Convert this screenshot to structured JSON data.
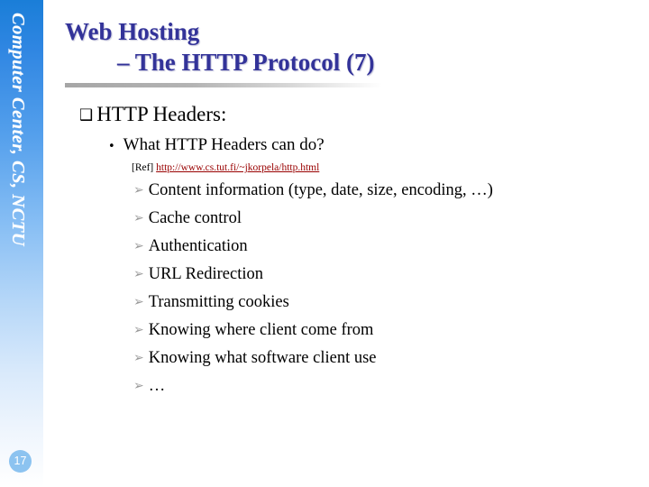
{
  "slide": {
    "page_number": "17",
    "sidebar_text": "Computer Center, CS, NCTU",
    "accent_blue": "#1a7ed8",
    "title_color": "#333399",
    "link_color": "#990000",
    "marker_gray": "#9a9a9a"
  },
  "title": {
    "line1": "Web Hosting",
    "line2": "– The HTTP Protocol (7)"
  },
  "content": {
    "heading": {
      "marker": "❑",
      "text": "HTTP Headers:"
    },
    "subheading": {
      "marker": "•",
      "text": "What HTTP Headers can do?"
    },
    "reference": {
      "label": "[Ref]",
      "url": "http://www.cs.tut.fi/~jkorpela/http.html"
    },
    "list_marker": "➢",
    "items": [
      "Content information (type, date, size, encoding, …)",
      "Cache control",
      "Authentication",
      "URL Redirection",
      "Transmitting cookies",
      "Knowing where client come from",
      "Knowing what software client use",
      "…"
    ]
  }
}
